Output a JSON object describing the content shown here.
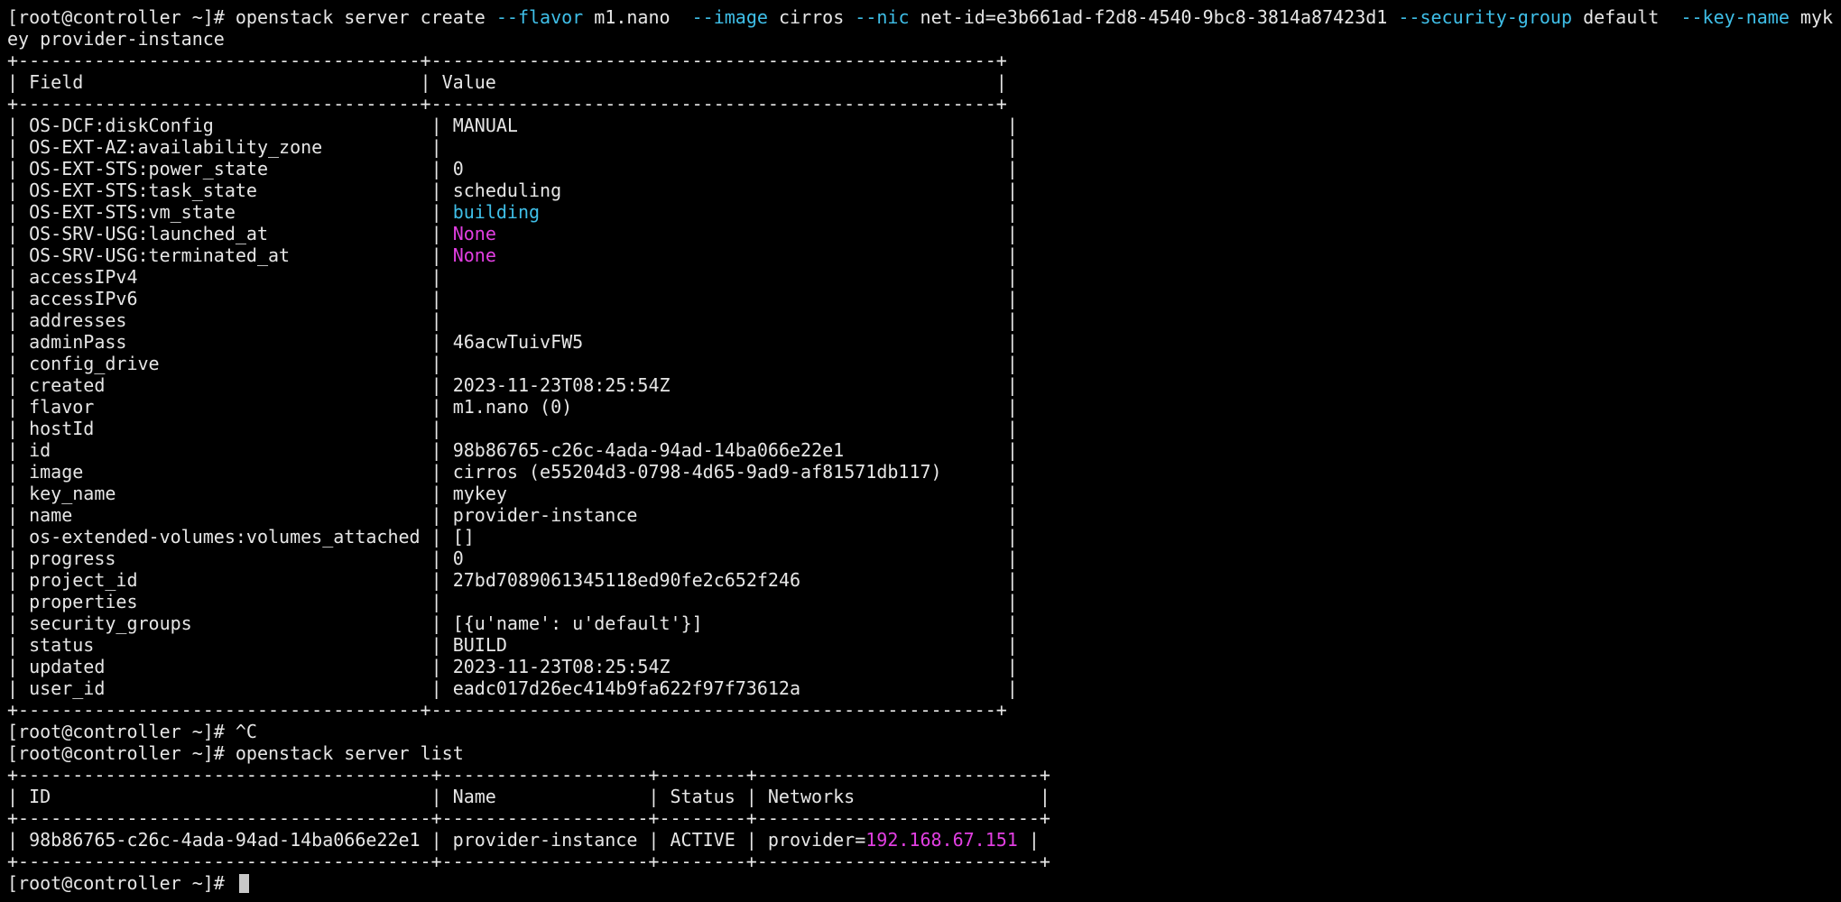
{
  "terminal": {
    "prompt": "[root@controller ~]# ",
    "colors": {
      "background": "#000000",
      "text": "#e6e6e6",
      "option_cyan": "#3fbfe8",
      "magenta": "#e23fe2"
    },
    "command1": {
      "base": "openstack server create",
      "flavor_opt": "--flavor",
      "flavor": "m1.nano",
      "image_opt": "--image",
      "image": "cirros",
      "nic_opt": "--nic",
      "nic": "net-id=e3b661ad-f2d8-4540-9bc8-3814a87423d1",
      "secgroup_opt": "--security-group",
      "secgroup": "default",
      "keyname_opt": "--key-name",
      "keyname_start": "myk",
      "wrap": "ey provider-instance"
    },
    "create_table": {
      "sep": "+-------------------------------------+----------------------------------------------------+",
      "header": "| Field                               | Value                                              |",
      "rows": [
        [
          "OS-DCF:diskConfig",
          "MANUAL"
        ],
        [
          "OS-EXT-AZ:availability_zone",
          ""
        ],
        [
          "OS-EXT-STS:power_state",
          "0"
        ],
        [
          "OS-EXT-STS:task_state",
          "scheduling"
        ],
        [
          "OS-EXT-STS:vm_state",
          "building"
        ],
        [
          "OS-SRV-USG:launched_at",
          "None"
        ],
        [
          "OS-SRV-USG:terminated_at",
          "None"
        ],
        [
          "accessIPv4",
          ""
        ],
        [
          "accessIPv6",
          ""
        ],
        [
          "addresses",
          ""
        ],
        [
          "adminPass",
          "46acwTuivFW5"
        ],
        [
          "config_drive",
          ""
        ],
        [
          "created",
          "2023-11-23T08:25:54Z"
        ],
        [
          "flavor",
          "m1.nano (0)"
        ],
        [
          "hostId",
          ""
        ],
        [
          "id",
          "98b86765-c26c-4ada-94ad-14ba066e22e1"
        ],
        [
          "image",
          "cirros (e55204d3-0798-4d65-9ad9-af81571db117)"
        ],
        [
          "key_name",
          "mykey"
        ],
        [
          "name",
          "provider-instance"
        ],
        [
          "os-extended-volumes:volumes_attached",
          "[]"
        ],
        [
          "progress",
          "0"
        ],
        [
          "project_id",
          "27bd7089061345118ed90fe2c652f246"
        ],
        [
          "properties",
          ""
        ],
        [
          "security_groups",
          "[{u'name': u'default'}]"
        ],
        [
          "status",
          "BUILD"
        ],
        [
          "updated",
          "2023-11-23T08:25:54Z"
        ],
        [
          "user_id",
          "eadc017d26ec414b9fa622f97f73612a"
        ]
      ]
    },
    "interrupt": "^C",
    "command2": "openstack server list",
    "list_table": {
      "sep": "+--------------------------------------+-------------------+--------+--------------------------+",
      "header": "| ID                                   | Name              | Status | Networks                 |",
      "row_prefix": "| 98b86765-c26c-4ada-94ad-14ba066e22e1 | provider-instance | ACTIVE | provider=",
      "row_ip": "192.168.67.151",
      "row_suffix": " |"
    }
  }
}
